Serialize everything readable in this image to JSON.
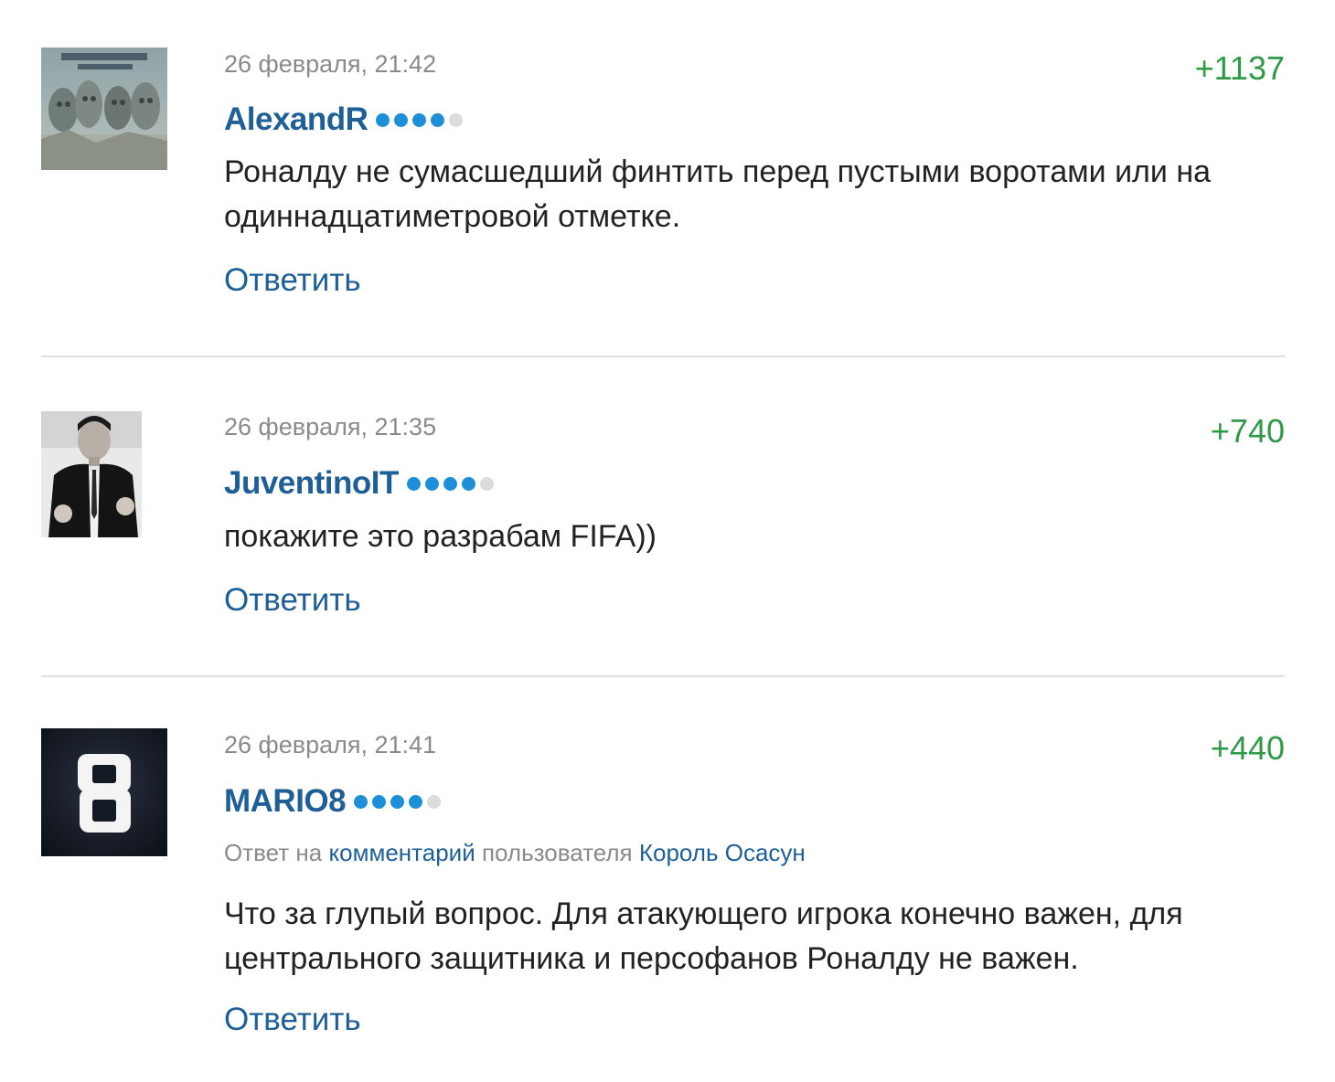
{
  "comments": [
    {
      "date": "26 февраля, 21:42",
      "score": "+1137",
      "username": "AlexandR",
      "rating_filled": 4,
      "rating_total": 5,
      "text": "Роналду не сумасшедший финтить перед пустыми воротами или на одиннадцатиметровой отметке.",
      "reply_label": "Ответить",
      "avatar": "album-cover-avatar"
    },
    {
      "date": "26 февраля, 21:35",
      "score": "+740",
      "username": "JuventinoIT",
      "rating_filled": 4,
      "rating_total": 5,
      "text": "покажите это разрабам FIFA))",
      "reply_label": "Ответить",
      "avatar": "man-in-suit-avatar"
    },
    {
      "date": "26 февраля, 21:41",
      "score": "+440",
      "username": "MARIO8",
      "rating_filled": 4,
      "rating_total": 5,
      "reply_to": {
        "prefix": "Ответ на",
        "link": "комментарий",
        "middle": "пользователя",
        "user": "Король Осасун"
      },
      "text": "Что за глупый вопрос. Для атакующего игрока конечно важен, для центрального защитника и персофанов Роналду не важен.",
      "reply_label": "Ответить",
      "avatar": "number-8-avatar"
    }
  ],
  "colors": {
    "score": "#2e9a46",
    "link": "#1e5f98",
    "rating_dot": "#1d8fd8",
    "rating_dot_off": "#dcdcdc",
    "meta": "#8a8a8a",
    "divider": "#e0e0e0"
  }
}
